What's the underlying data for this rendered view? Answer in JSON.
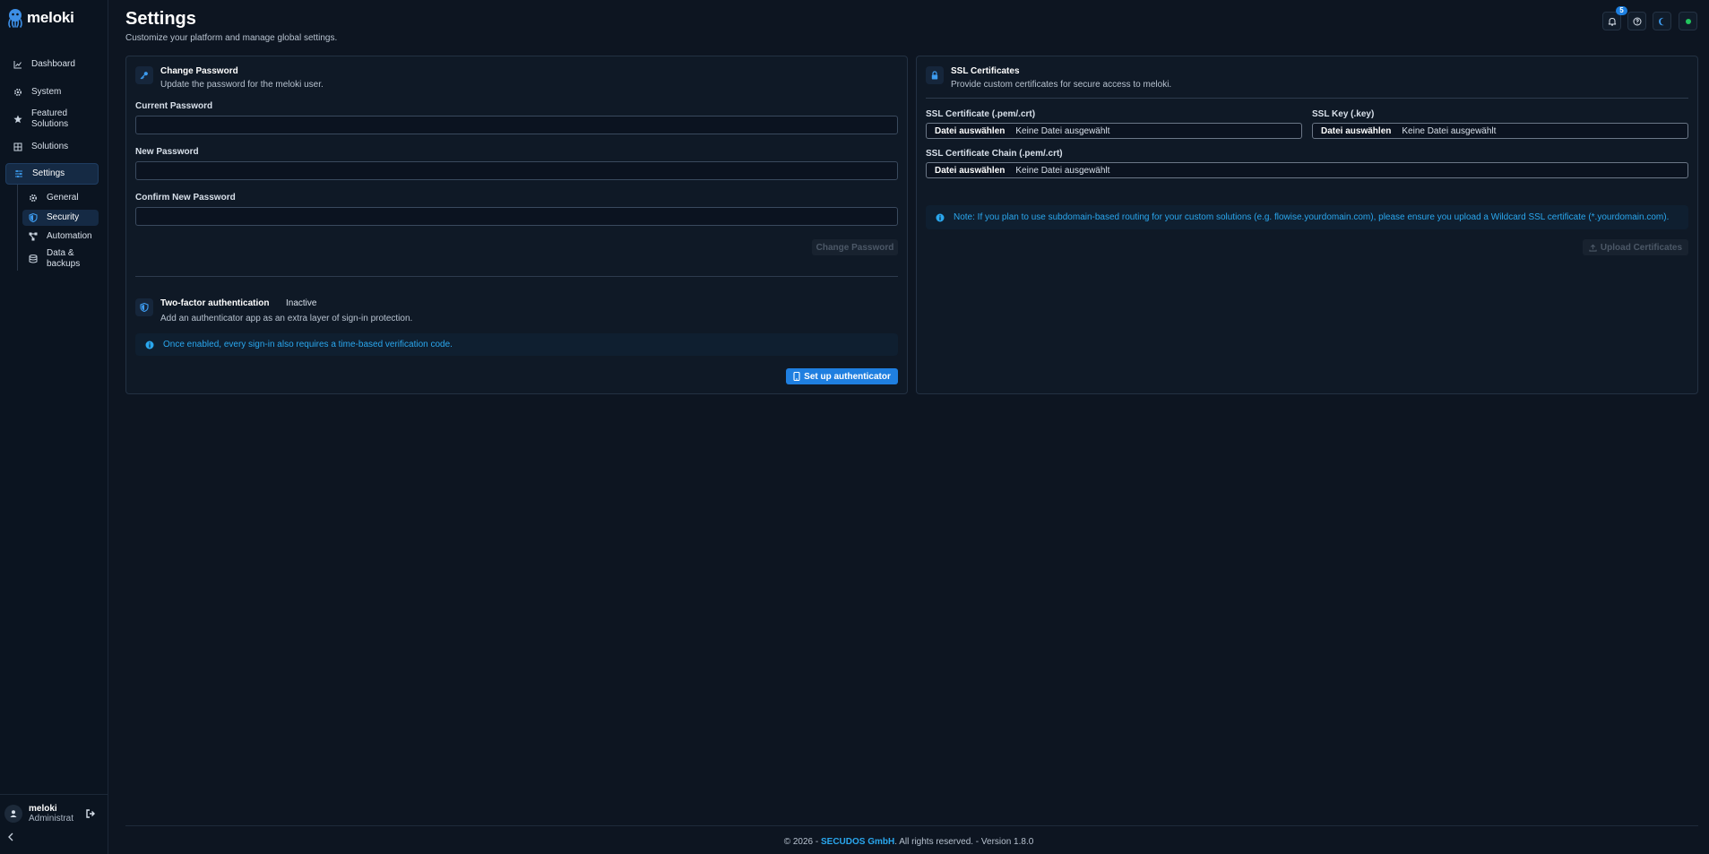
{
  "app": {
    "name": "meloki"
  },
  "sidebar": {
    "items": [
      {
        "label": "Dashboard",
        "icon": "chart-line-icon"
      },
      {
        "label": "System",
        "icon": "gear-icon"
      },
      {
        "label": "Featured Solutions",
        "icon": "star-icon"
      },
      {
        "label": "Solutions",
        "icon": "grid-icon"
      },
      {
        "label": "Settings",
        "icon": "sliders-icon",
        "active": true
      }
    ],
    "settings_sub": [
      {
        "label": "General",
        "icon": "gear-icon"
      },
      {
        "label": "Security",
        "icon": "shield-icon",
        "active": true
      },
      {
        "label": "Automation",
        "icon": "workflow-icon"
      },
      {
        "label": "Data & backups",
        "icon": "database-icon"
      }
    ],
    "user": {
      "name": "meloki",
      "role": "Administrator"
    }
  },
  "header": {
    "title": "Settings",
    "subtitle": "Customize your platform and manage global settings.",
    "notifications_count": "5"
  },
  "password_card": {
    "title": "Change Password",
    "description": "Update the password for the meloki user.",
    "current_label": "Current Password",
    "current_value": "",
    "new_label": "New Password",
    "new_value": "",
    "confirm_label": "Confirm New Password",
    "confirm_value": "",
    "submit_label": "Change Password"
  },
  "twofa": {
    "title": "Two-factor authentication",
    "status": "Inactive",
    "description": "Add an authenticator app as an extra layer of sign-in protection.",
    "info": "Once enabled, every sign-in also requires a time-based verification code.",
    "button_label": "Set up authenticator"
  },
  "ssl_card": {
    "title": "SSL Certificates",
    "description": "Provide custom certificates for secure access to meloki.",
    "cert_label": "SSL Certificate (.pem/.crt)",
    "key_label": "SSL Key (.key)",
    "chain_label": "SSL Certificate Chain (.pem/.crt)",
    "choose_file": "Datei auswählen",
    "no_file": "Keine Datei ausgewählt",
    "note": "Note: If you plan to use subdomain-based routing for your custom solutions (e.g. flowise.yourdomain.com), please ensure you upload a Wildcard SSL certificate (*.yourdomain.com).",
    "upload_label": "Upload Certificates"
  },
  "footer": {
    "prefix": "© 2026 -",
    "company": "SECUDOS GmbH",
    "suffix": ". All rights reserved. - Version 1.8.0"
  },
  "colors": {
    "accent": "#1f7fe0",
    "info_text": "#2aa7ee",
    "status_online": "#22c55e"
  }
}
